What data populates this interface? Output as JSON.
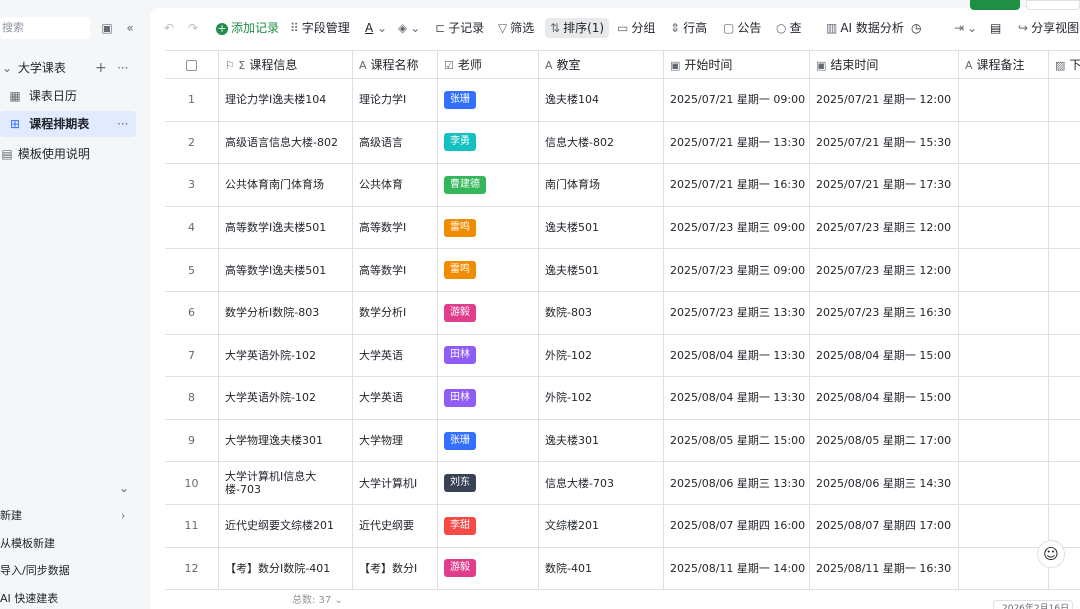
{
  "sidebar": {
    "search_placeholder": "搜索",
    "base_name": "大学课表",
    "items": [
      {
        "icon": "calendar-icon",
        "glyph": "▦",
        "label": "课表日历"
      },
      {
        "icon": "grid-table-icon",
        "glyph": "⊞",
        "label": "课程排期表"
      },
      {
        "icon": "doc-icon",
        "glyph": "▤",
        "label": "模板使用说明"
      }
    ],
    "bottom": [
      "新建",
      "从模板新建",
      "导入/同步数据",
      "AI 快速建表"
    ]
  },
  "toolbar": {
    "add": "添加记录",
    "fields": "字段管理",
    "sub_record": "子记录",
    "filter": "筛选",
    "sort": "排序(1)",
    "group": "分组",
    "row_height": "行高",
    "notice": "公告",
    "find": "查",
    "ai_analysis": "AI 数据分析",
    "share": "分享视图"
  },
  "columns": [
    {
      "label": "课程信息",
      "icon": "⚐ Σ"
    },
    {
      "label": "课程名称",
      "icon": "A"
    },
    {
      "label": "老师",
      "icon": "☑"
    },
    {
      "label": "教室",
      "icon": "A"
    },
    {
      "label": "开始时间",
      "icon": "▣"
    },
    {
      "label": "结束时间",
      "icon": "▣"
    },
    {
      "label": "课程备注",
      "icon": "A"
    },
    {
      "label": "下",
      "icon": "▨"
    }
  ],
  "rows": [
    {
      "n": "1",
      "info": "理论力学I逸夫楼104",
      "course": "理论力学I",
      "teacher": "张珊",
      "tcolor": "#3370ff",
      "room": "逸夫楼104",
      "start": "2025/07/21 星期一 09:00",
      "end": "2025/07/21 星期一 12:00"
    },
    {
      "n": "2",
      "info": "高级语言信息大楼-802",
      "course": "高级语言",
      "teacher": "李勇",
      "tcolor": "#14c0c0",
      "room": "信息大楼-802",
      "start": "2025/07/21 星期一 13:30",
      "end": "2025/07/21 星期一 15:30"
    },
    {
      "n": "3",
      "info": "公共体育南门体育场",
      "course": "公共体育",
      "teacher": "曹建德",
      "tcolor": "#34b65a",
      "room": "南门体育场",
      "start": "2025/07/21 星期一 16:30",
      "end": "2025/07/21 星期一 17:30"
    },
    {
      "n": "4",
      "info": "高等数学I逸夫楼501",
      "course": "高等数学I",
      "teacher": "雷鸣",
      "tcolor": "#f08c00",
      "room": "逸夫楼501",
      "start": "2025/07/23 星期三 09:00",
      "end": "2025/07/23 星期三 12:00"
    },
    {
      "n": "5",
      "info": "高等数学I逸夫楼501",
      "course": "高等数学I",
      "teacher": "雷鸣",
      "tcolor": "#f08c00",
      "room": "逸夫楼501",
      "start": "2025/07/23 星期三 09:00",
      "end": "2025/07/23 星期三 12:00"
    },
    {
      "n": "6",
      "info": "数学分析I数院-803",
      "course": "数学分析I",
      "teacher": "游毅",
      "tcolor": "#e03e8c",
      "room": "数院-803",
      "start": "2025/07/23 星期三 13:30",
      "end": "2025/07/23 星期三 16:30"
    },
    {
      "n": "7",
      "info": "大学英语外院-102",
      "course": "大学英语",
      "teacher": "田林",
      "tcolor": "#8f5cf6",
      "room": "外院-102",
      "start": "2025/08/04 星期一 13:30",
      "end": "2025/08/04 星期一 15:00"
    },
    {
      "n": "8",
      "info": "大学英语外院-102",
      "course": "大学英语",
      "teacher": "田林",
      "tcolor": "#8f5cf6",
      "room": "外院-102",
      "start": "2025/08/04 星期一 13:30",
      "end": "2025/08/04 星期一 15:00"
    },
    {
      "n": "9",
      "info": "大学物理逸夫楼301",
      "course": "大学物理",
      "teacher": "张珊",
      "tcolor": "#3370ff",
      "room": "逸夫楼301",
      "start": "2025/08/05 星期二 15:00",
      "end": "2025/08/05 星期二 17:00"
    },
    {
      "n": "10",
      "info": "大学计算机Ⅰ信息大楼-703",
      "course": "大学计算机Ⅰ",
      "teacher": "刘东",
      "tcolor": "#3a4255",
      "room": "信息大楼-703",
      "start": "2025/08/06 星期三 13:30",
      "end": "2025/08/06 星期三 14:30"
    },
    {
      "n": "11",
      "info": "近代史纲要文综楼201",
      "course": "近代史纲要",
      "teacher": "李甜",
      "tcolor": "#f54a45",
      "room": "文综楼201",
      "start": "2025/08/07 星期四 16:00",
      "end": "2025/08/07 星期四 17:00"
    },
    {
      "n": "12",
      "info": "【考】数分I数院-401",
      "course": "【考】数分I",
      "teacher": "游毅",
      "tcolor": "#e03e8c",
      "room": "数院-401",
      "start": "2025/08/11 星期一 14:00",
      "end": "2025/08/11 星期一 16:30"
    }
  ],
  "footer": {
    "total": "总数: 37"
  },
  "bottom_date": "2026年2月16日"
}
